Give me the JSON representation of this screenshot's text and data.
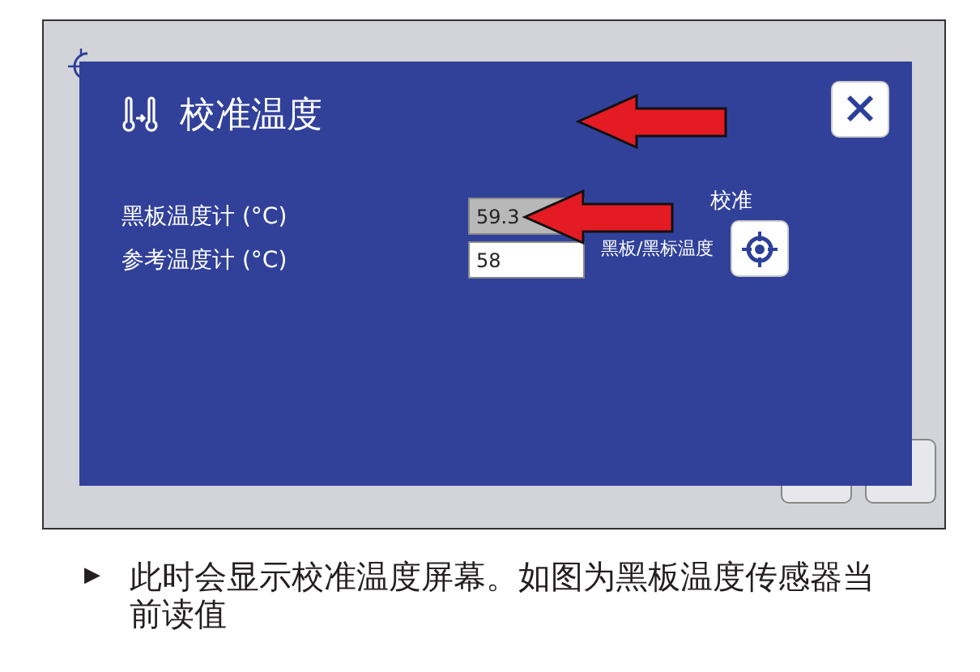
{
  "dialog": {
    "title": "校准温度",
    "fields": [
      {
        "label": "黑板温度计 (°C)",
        "value": "59.3",
        "disabled": true
      },
      {
        "label": "参考温度计 (°C)",
        "value": "58",
        "disabled": false
      }
    ],
    "calibrate": {
      "heading": "校准",
      "label": "黑板/黑标温度"
    }
  },
  "annotations": [
    {
      "kind": "arrow"
    },
    {
      "kind": "arrow"
    }
  ],
  "caption": {
    "bullet": "▶",
    "text": "此时会显示校准温度屏幕。如图为黑板温度传感器当前读值"
  }
}
